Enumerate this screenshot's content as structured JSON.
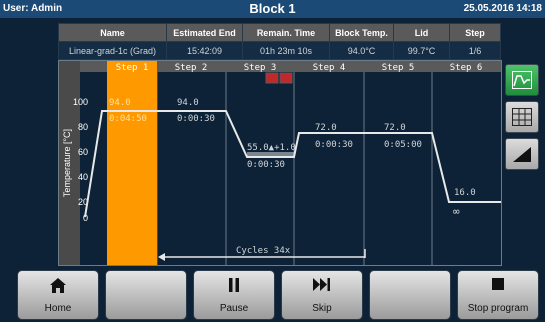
{
  "header": {
    "user": "User: Admin",
    "block": "Block 1",
    "datetime": "25.05.2016 14:18"
  },
  "info_table": {
    "headers": [
      "Name",
      "Estimated End",
      "Remain. Time",
      "Block Temp.",
      "Lid",
      "Step"
    ],
    "values": [
      "Linear-grad-1c (Grad)",
      "15:42:09",
      "01h 23m 10s",
      "94.0°C",
      "99.7°C",
      "1/6"
    ]
  },
  "profile": {
    "y_axis_label": "Temperature [°C]",
    "y_ticks": [
      "100",
      "80",
      "60",
      "40",
      "20",
      "0"
    ],
    "steps": [
      {
        "name": "Step 1",
        "temp": "94.0",
        "time": "0:04:50"
      },
      {
        "name": "Step 2",
        "temp": "94.0",
        "time": "0:00:30"
      },
      {
        "name": "Step 3",
        "temp": "55.0▲+1.0",
        "time": "0:00:30"
      },
      {
        "name": "Step 4",
        "temp": "72.0",
        "time": "0:00:30"
      },
      {
        "name": "Step 5",
        "temp": "72.0",
        "time": "0:05:00"
      },
      {
        "name": "Step 6",
        "temp": "16.0",
        "time": "∞"
      }
    ],
    "active_step": 1,
    "cycles_label": "Cycles 34x",
    "colors": {
      "active": "#ff9900",
      "curve": "#e8e8e8",
      "flag": "#c0282a"
    }
  },
  "side_buttons": [
    {
      "name": "profile-view",
      "icon": "chart-line-icon",
      "active": true
    },
    {
      "name": "table-view",
      "icon": "grid-icon",
      "active": false
    },
    {
      "name": "ramp-view",
      "icon": "ramp-icon",
      "active": false
    }
  ],
  "bottom_buttons": [
    {
      "label": "Home",
      "icon": "home-icon"
    },
    {
      "label": "",
      "icon": ""
    },
    {
      "label": "Pause",
      "icon": "pause-icon"
    },
    {
      "label": "Skip",
      "icon": "skip-icon"
    },
    {
      "label": "",
      "icon": ""
    },
    {
      "label": "Stop program",
      "icon": "stop-icon"
    }
  ]
}
